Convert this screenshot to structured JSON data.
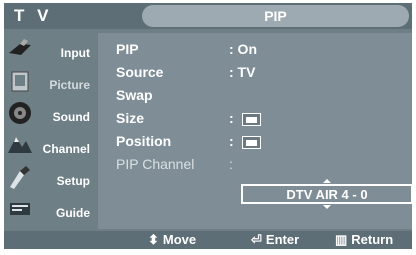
{
  "header": {
    "tv_title": "T V",
    "menu_title": "PIP"
  },
  "sidebar": {
    "items": [
      {
        "label": "Input",
        "icon": "input-icon"
      },
      {
        "label": "Picture",
        "icon": "picture-icon"
      },
      {
        "label": "Sound",
        "icon": "sound-icon"
      },
      {
        "label": "Channel",
        "icon": "channel-icon"
      },
      {
        "label": "Setup",
        "icon": "setup-icon"
      },
      {
        "label": "Guide",
        "icon": "guide-icon"
      }
    ]
  },
  "menu": {
    "pip": {
      "label": "PIP",
      "value": ": On"
    },
    "source": {
      "label": "Source",
      "value": ": TV"
    },
    "swap": {
      "label": "Swap"
    },
    "size": {
      "label": "Size",
      "value": ":"
    },
    "position": {
      "label": "Position",
      "value": ":"
    },
    "pip_channel": {
      "label": "PIP Channel",
      "value": ":",
      "selected": "DTV AIR 4 - 0"
    }
  },
  "footer": {
    "move": "Move",
    "enter": "Enter",
    "return": "Return"
  },
  "colors": {
    "background": "#6f7f86",
    "panel": "#7f8e96",
    "header": "#5d6e77",
    "tab": "#9eaab1"
  }
}
